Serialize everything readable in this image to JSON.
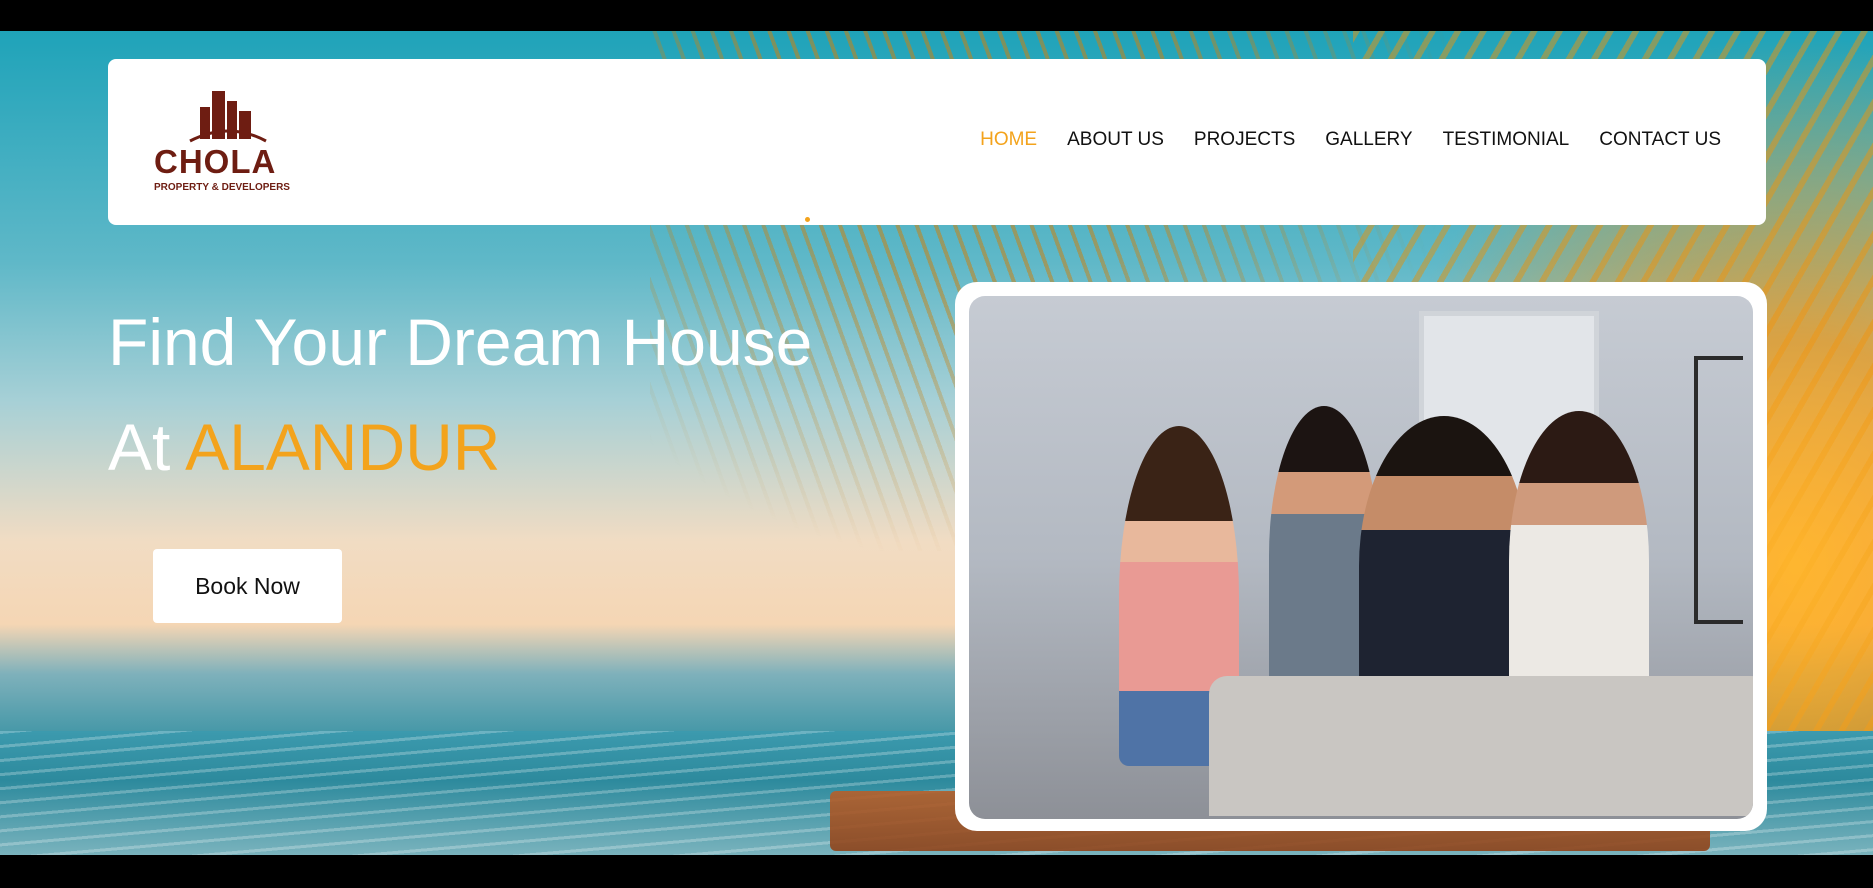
{
  "brand": {
    "name": "CHOLA",
    "tagline": "PROPERTY & DEVELOPERS",
    "color": "#6e1d12"
  },
  "nav": {
    "items": [
      {
        "label": "HOME",
        "active": true
      },
      {
        "label": "ABOUT US",
        "active": false
      },
      {
        "label": "PROJECTS",
        "active": false
      },
      {
        "label": "GALLERY",
        "active": false
      },
      {
        "label": "TESTIMONIAL",
        "active": false
      },
      {
        "label": "CONTACT US",
        "active": false
      }
    ]
  },
  "hero": {
    "line1": "Find Your Dream House",
    "line2_prefix": "At",
    "line2_accent": "ALANDUR",
    "cta_label": "Book Now"
  },
  "colors": {
    "accent": "#f3a31c",
    "text_dark": "#111111",
    "white": "#ffffff"
  }
}
